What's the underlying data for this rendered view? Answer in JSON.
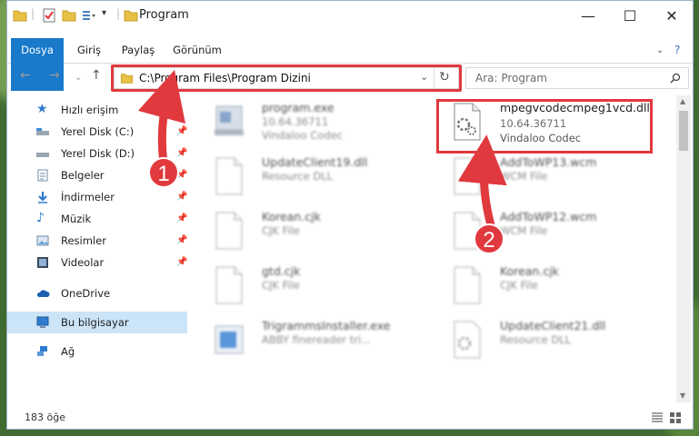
{
  "window": {
    "title": "Program"
  },
  "ribbon": {
    "tabs": [
      "Dosya",
      "Giriş",
      "Paylaş",
      "Görünüm"
    ],
    "help": "?"
  },
  "address": {
    "path": "C:\\Program Files\\Program Dizini"
  },
  "search": {
    "placeholder": "Ara: Program"
  },
  "sidebar": {
    "items": [
      {
        "label": "Hızlı erişim",
        "icon": "star-icon"
      },
      {
        "label": "Yerel Disk (C:)",
        "icon": "drive-icon"
      },
      {
        "label": "Yerel Disk (D:)",
        "icon": "drive-icon"
      },
      {
        "label": "Belgeler",
        "icon": "documents-icon"
      },
      {
        "label": "İndirmeler",
        "icon": "download-icon"
      },
      {
        "label": "Müzik",
        "icon": "music-icon"
      },
      {
        "label": "Resimler",
        "icon": "pictures-icon"
      },
      {
        "label": "Videolar",
        "icon": "video-icon"
      },
      {
        "label": "OneDrive",
        "icon": "cloud-icon"
      },
      {
        "label": "Bu bilgisayar",
        "icon": "computer-icon"
      },
      {
        "label": "Ağ",
        "icon": "network-icon"
      }
    ]
  },
  "files": [
    {
      "name": "program.exe",
      "line1": "10.64.36711",
      "line2": "Vindaloo Codec"
    },
    {
      "name": "mpegvcodecmpeg1vcd.dll",
      "line1": "10.64.36711",
      "line2": "Vindaloo Codec"
    },
    {
      "name": "UpdateClient19.dll",
      "line1": "Resource DLL"
    },
    {
      "name": "AddToWP13.wcm",
      "line1": "WCM File"
    },
    {
      "name": "Korean.cjk",
      "line1": "CJK File"
    },
    {
      "name": "AddToWP12.wcm",
      "line1": "WCM File"
    },
    {
      "name": "gtd.cjk",
      "line1": "CJK File"
    },
    {
      "name": "Korean.cjk",
      "line1": "CJK File"
    },
    {
      "name": "TrigrammsInstaller.exe",
      "line1": "ABBY finereader tri..."
    },
    {
      "name": "UpdateClient21.dll",
      "line1": "Resource DLL"
    }
  ],
  "status": {
    "count": "183 öğe"
  },
  "callouts": [
    "1",
    "2"
  ],
  "colors": {
    "highlight": "#e0393e",
    "accent": "#1979ca",
    "selected": "#cce4f7"
  }
}
